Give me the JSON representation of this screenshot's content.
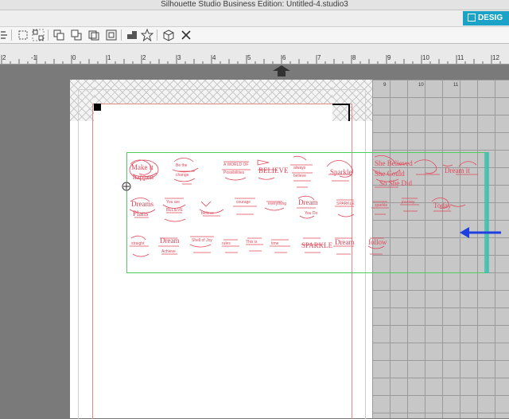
{
  "window": {
    "title": "Silhouette Studio Business Edition: Untitled-4.studio3"
  },
  "tabs": {
    "design_label": "DESIG"
  },
  "toolbar": {
    "icons": [
      "align-icon",
      "group-icon",
      "ungroup-icon",
      "bring-forward-icon",
      "send-backward-icon",
      "weld-icon",
      "replicate-icon",
      "box-icon",
      "close-icon"
    ]
  },
  "ruler": {
    "labels": [
      "2",
      "-1",
      "0",
      "1",
      "2",
      "3",
      "4",
      "5",
      "6",
      "7",
      "8",
      "9",
      "10",
      "11",
      "12"
    ]
  },
  "grid": {
    "labels": [
      "9",
      "10",
      "11"
    ]
  },
  "accent": "#1aa3c6",
  "design_color": "#e0485a",
  "selection_color": "#4ecf5a",
  "arrow_color": "#1f3fe0"
}
